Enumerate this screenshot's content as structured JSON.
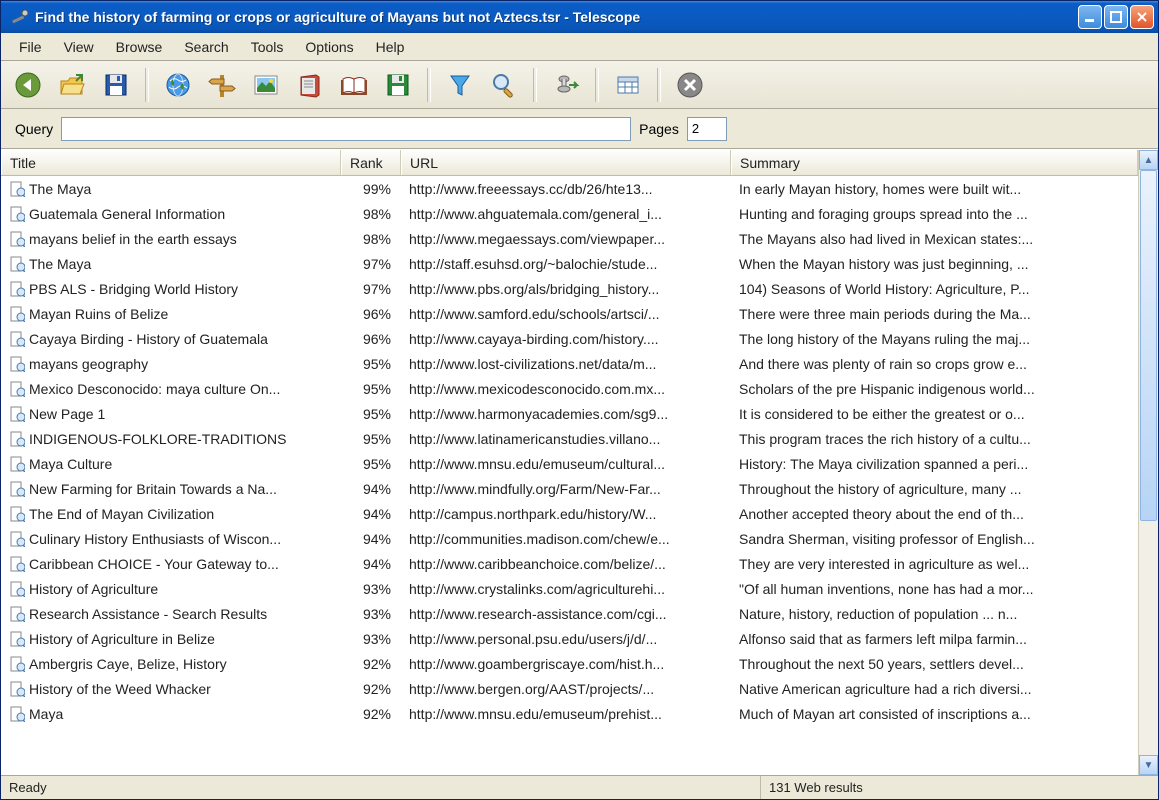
{
  "window": {
    "title": "Find the history of farming or crops or agriculture of Mayans but not Aztecs.tsr - Telescope"
  },
  "menu": {
    "items": [
      "File",
      "View",
      "Browse",
      "Search",
      "Tools",
      "Options",
      "Help"
    ]
  },
  "toolbar": {
    "icons": [
      "back-icon",
      "open-icon",
      "save-icon",
      "globe-icon",
      "signpost-icon",
      "picture-icon",
      "book-icon",
      "openbook-icon",
      "save-green-icon",
      "funnel-icon",
      "magnifier-icon",
      "pin-icon",
      "table-icon",
      "stop-icon"
    ]
  },
  "query": {
    "label": "Query",
    "value": "",
    "pages_label": "Pages",
    "pages_value": "2"
  },
  "columns": {
    "title": "Title",
    "rank": "Rank",
    "url": "URL",
    "summary": "Summary"
  },
  "results": [
    {
      "title": "The Maya",
      "rank": "99%",
      "url": "http://www.freeessays.cc/db/26/hte13...",
      "summary": "In early Mayan history, homes were built wit..."
    },
    {
      "title": "Guatemala General Information",
      "rank": "98%",
      "url": "http://www.ahguatemala.com/general_i...",
      "summary": "Hunting and foraging groups spread into the ..."
    },
    {
      "title": "mayans belief in the earth essays",
      "rank": "98%",
      "url": "http://www.megaessays.com/viewpaper...",
      "summary": "The Mayans also had lived in Mexican states:..."
    },
    {
      "title": "The Maya",
      "rank": "97%",
      "url": "http://staff.esuhsd.org/~balochie/stude...",
      "summary": "When the Mayan history was just beginning, ..."
    },
    {
      "title": "PBS ALS - Bridging World History",
      "rank": "97%",
      "url": "http://www.pbs.org/als/bridging_history...",
      "summary": "104) Seasons of World History: Agriculture, P..."
    },
    {
      "title": "Mayan Ruins of Belize",
      "rank": "96%",
      "url": "http://www.samford.edu/schools/artsci/...",
      "summary": "There were three main periods during the Ma..."
    },
    {
      "title": "Cayaya Birding - History of Guatemala",
      "rank": "96%",
      "url": "http://www.cayaya-birding.com/history....",
      "summary": "The long history of the Mayans ruling the maj..."
    },
    {
      "title": "mayans geography",
      "rank": "95%",
      "url": "http://www.lost-civilizations.net/data/m...",
      "summary": "And there was plenty of rain so crops grow e..."
    },
    {
      "title": "Mexico Desconocido: maya culture On...",
      "rank": "95%",
      "url": "http://www.mexicodesconocido.com.mx...",
      "summary": "Scholars of the pre Hispanic indigenous world..."
    },
    {
      "title": "New Page 1",
      "rank": "95%",
      "url": "http://www.harmonyacademies.com/sg9...",
      "summary": "It is considered to be either the greatest or o..."
    },
    {
      "title": "INDIGENOUS-FOLKLORE-TRADITIONS",
      "rank": "95%",
      "url": "http://www.latinamericanstudies.villano...",
      "summary": "This program traces the rich history of a cultu..."
    },
    {
      "title": "Maya Culture",
      "rank": "95%",
      "url": "http://www.mnsu.edu/emuseum/cultural...",
      "summary": "History: The Maya civilization spanned a peri..."
    },
    {
      "title": "New Farming for Britain Towards a Na...",
      "rank": "94%",
      "url": "http://www.mindfully.org/Farm/New-Far...",
      "summary": "Throughout the history of agriculture, many ..."
    },
    {
      "title": "The End of Mayan Civilization",
      "rank": "94%",
      "url": "http://campus.northpark.edu/history/W...",
      "summary": "Another accepted theory about the end of th..."
    },
    {
      "title": "Culinary History Enthusiasts of Wiscon...",
      "rank": "94%",
      "url": "http://communities.madison.com/chew/e...",
      "summary": "Sandra Sherman, visiting professor of English..."
    },
    {
      "title": "Caribbean CHOICE - Your Gateway to...",
      "rank": "94%",
      "url": "http://www.caribbeanchoice.com/belize/...",
      "summary": "They are very interested in agriculture as wel..."
    },
    {
      "title": "History of Agriculture",
      "rank": "93%",
      "url": "http://www.crystalinks.com/agriculturehi...",
      "summary": "\"Of all human inventions, none has had a mor..."
    },
    {
      "title": "Research Assistance - Search Results",
      "rank": "93%",
      "url": "http://www.research-assistance.com/cgi...",
      "summary": "Nature, history, reduction of population ... n..."
    },
    {
      "title": "History of Agriculture in Belize",
      "rank": "93%",
      "url": "http://www.personal.psu.edu/users/j/d/...",
      "summary": "Alfonso said that as farmers left milpa farmin..."
    },
    {
      "title": "Ambergris Caye, Belize, History",
      "rank": "92%",
      "url": "http://www.goambergriscaye.com/hist.h...",
      "summary": "Throughout the next 50 years, settlers devel..."
    },
    {
      "title": "History of the Weed Whacker",
      "rank": "92%",
      "url": "http://www.bergen.org/AAST/projects/...",
      "summary": "Native American agriculture had a rich diversi..."
    },
    {
      "title": "Maya",
      "rank": "92%",
      "url": "http://www.mnsu.edu/emuseum/prehist...",
      "summary": "Much of Mayan art consisted of inscriptions a..."
    }
  ],
  "status": {
    "ready": "Ready",
    "results": "131 Web results"
  }
}
